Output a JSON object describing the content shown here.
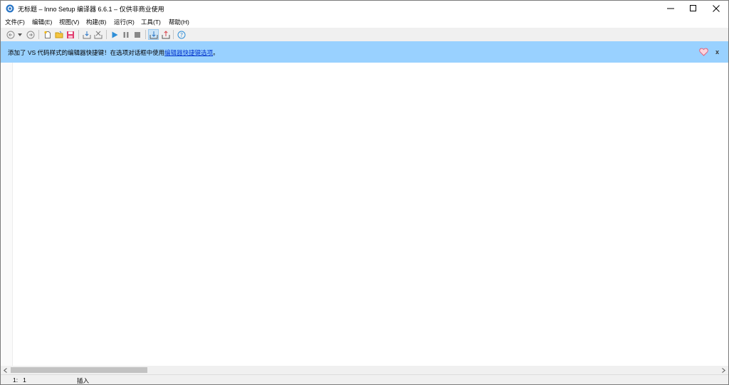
{
  "window": {
    "title": "无标题 – Inno Setup 编译器 6.6.1 – 仅供非商业使用"
  },
  "menu": [
    {
      "label": "文件(F)"
    },
    {
      "label": "编辑(E)"
    },
    {
      "label": "视图(V)"
    },
    {
      "label": "构建(B)"
    },
    {
      "label": "运行(R)"
    },
    {
      "label": "工具(T)"
    },
    {
      "label": "帮助(H)"
    }
  ],
  "toolbar": {
    "icons": [
      "back-icon",
      "dropdown-arrow-icon",
      "forward-icon",
      "new-file-icon",
      "open-file-icon",
      "save-file-icon",
      "compile-icon",
      "stop-compile-icon",
      "run-icon",
      "pause-icon",
      "stop-icon",
      "target-setup-icon",
      "target-uninstall-icon",
      "help-icon"
    ],
    "pressed": "target-setup-icon"
  },
  "notification": {
    "text": "添加了 VS 代码样式的编辑器快捷键！在选项对话框中使用",
    "link": "编辑器快捷键选项",
    "suffix": "。",
    "close_label": "x",
    "heart_icon": "heart-icon"
  },
  "status": {
    "position": "1:   1",
    "mode": "插入"
  },
  "colors": {
    "notification_bg": "#99d1ff",
    "toolbar_bg": "#f0f0f0",
    "pressed_bg": "#cce4f7",
    "heart": "#e0607a",
    "accent": "#1e90ff"
  }
}
